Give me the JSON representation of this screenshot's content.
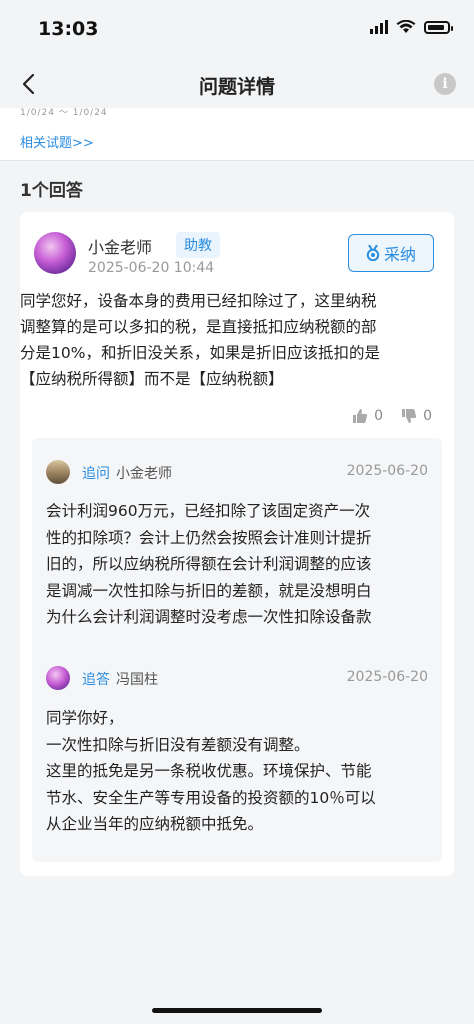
{
  "status_bar": {
    "time": "13:03"
  },
  "nav": {
    "title": "问题详情",
    "info_symbol": "i"
  },
  "question": {
    "faded_text": "1/0/24 ～ 1/0/24",
    "related_link": "相关试题>>"
  },
  "answers_count": "1个回答",
  "answer": {
    "author": "小金老师",
    "role": "助教",
    "date": "2025-06-20 10:44",
    "accept_label": "采纳",
    "lines": [
      "同学您好，设备本身的费用已经扣除过了，这里纳税",
      "调整算的是可以多扣的税，是直接抵扣应纳税额的部",
      "分是10%，和折旧没关系，如果是折旧应该抵扣的是",
      "【应纳税所得额】而不是【应纳税额】"
    ],
    "likes": "0",
    "dislikes": "0"
  },
  "follow_up": {
    "label": "追问",
    "target": "小金老师",
    "date": "2025-06-20",
    "lines": [
      "会计利润960万元，已经扣除了该固定资产一次",
      "性的扣除项？会计上仍然会按照会计准则计提折",
      "旧的，所以应纳税所得额在会计利润调整的应该",
      "是调减一次性扣除与折旧的差额，就是没想明白",
      "为什么会计利润调整时没考虑一次性扣除设备款"
    ]
  },
  "follow_answer": {
    "label": "追答",
    "author": "冯国柱",
    "date": "2025-06-20",
    "lines": [
      "同学你好，",
      "一次性扣除与折旧没有差额没有调整。",
      "这里的抵免是另一条税收优惠。环境保护、节能",
      "节水、安全生产等专用设备的投资额的10％可以",
      "从企业当年的应纳税额中抵免。"
    ]
  },
  "colors": {
    "accent": "#2a8de0",
    "background": "#f3f4f6"
  },
  "icons": [
    "signal-icon",
    "wifi-icon",
    "battery-icon",
    "back-arrow-icon",
    "info-icon",
    "medal-icon",
    "thumbs-up-icon",
    "thumbs-down-icon"
  ]
}
